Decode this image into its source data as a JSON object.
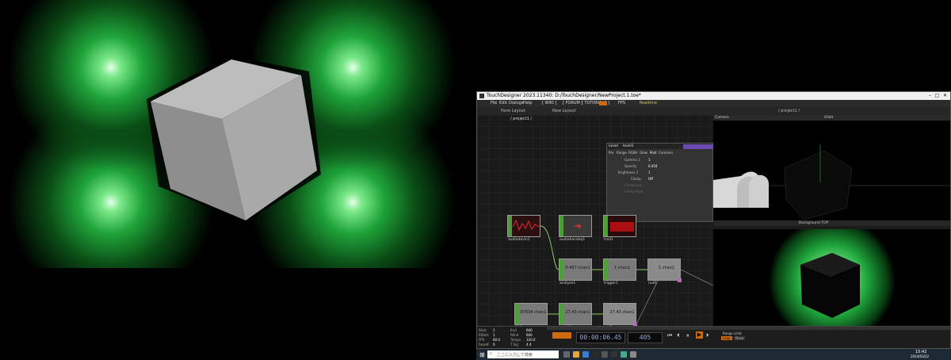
{
  "window": {
    "title": "TouchDesigner 2023.11340: D:/TouchDesigner/NewProject.1.toe*"
  },
  "menu": [
    "File",
    "Edit",
    "Dialogs",
    "Help"
  ],
  "toolbar_tags": [
    "[ WIKI ]",
    "[ FORUM ]",
    "[ TUTORIALS ]",
    "FPS",
    "Realtime"
  ],
  "panes": {
    "network_path": "/ project1 /",
    "viewer_path": "/ project1 /",
    "pane_layout": "Pane Layout",
    "new_layout": "New Layout"
  },
  "param_dialog": {
    "op_type": "Level",
    "op_name": "level1",
    "pages": [
      "Pre",
      "Range",
      "RGBA",
      "Glow",
      "Post",
      "Common"
    ],
    "rows": [
      {
        "label": "Gamma 1",
        "value": "1"
      },
      {
        "label": "Opacity",
        "value": "0.418"
      },
      {
        "label": "Brightness 2",
        "value": "1"
      },
      {
        "label": "Clamp",
        "value": "Off"
      },
      {
        "label": "Clamp Low",
        "value": ""
      },
      {
        "label": "Clamp High",
        "value": ""
      }
    ]
  },
  "nodes": [
    {
      "name": "audiodevin1",
      "label": ""
    },
    {
      "name": "audiobandeq1",
      "label": ""
    },
    {
      "name": "trail1",
      "label": ""
    },
    {
      "name": "analyze1",
      "label": "0.467 chan1"
    },
    {
      "name": "trigger1",
      "label": "1 chan1"
    },
    {
      "name": "null1",
      "label": "1 chan1"
    },
    {
      "name": "lfo1",
      "label": "87634 chan1"
    },
    {
      "name": "math1",
      "label": "27.43 chan1"
    },
    {
      "name": "null2",
      "label": "27.43 chan1"
    }
  ],
  "viewer_top": {
    "camera": "Camera",
    "mode": "Orbit"
  },
  "viewer_bottom": {
    "background": "Background TOP"
  },
  "timeline": {
    "timecode": "00:00:06.45",
    "frame": "405",
    "labels": [
      "Start",
      "End",
      "RStart",
      "REnd",
      "FPS",
      "Tempo",
      "ResetF",
      "T Sig"
    ],
    "values": [
      "1",
      "600",
      "1",
      "600",
      "60.0",
      "120.0",
      "0",
      "4  4"
    ],
    "range_limit": "Range Limit",
    "loop": "Loop",
    "once": "Once"
  },
  "taskbar": {
    "search_placeholder": "ここに入力して検索",
    "clock": "15:42",
    "date": "2024/03/22"
  },
  "colors": {
    "glow_green": "#1fa33a",
    "node_flag": "#4e9c3c",
    "timeline_highlight": "#d06a10"
  }
}
